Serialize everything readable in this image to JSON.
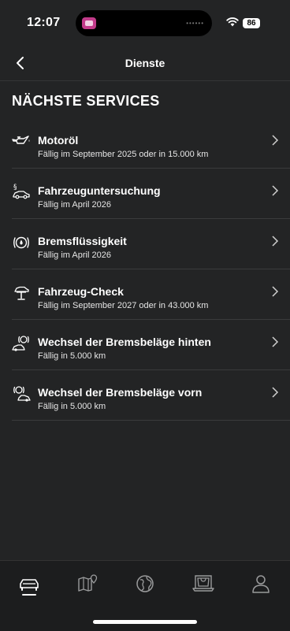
{
  "status": {
    "time": "12:07",
    "battery": "86"
  },
  "header": {
    "title": "Dienste"
  },
  "section_title": "NÄCHSTE SERVICES",
  "services": [
    {
      "icon": "oil-can-icon",
      "title": "Motoröl",
      "due": "Fällig im September 2025 oder in 15.000 km"
    },
    {
      "icon": "vehicle-inspection-icon",
      "title": "Fahrzeuguntersuchung",
      "due": "Fällig im April 2026"
    },
    {
      "icon": "brake-fluid-icon",
      "title": "Bremsflüssigkeit",
      "due": "Fällig im April 2026"
    },
    {
      "icon": "car-lift-icon",
      "title": "Fahrzeug-Check",
      "due": "Fällig im September 2027 oder in 43.000 km"
    },
    {
      "icon": "rear-brake-pads-icon",
      "title": "Wechsel der Bremsbeläge hinten",
      "due": "Fällig in 5.000 km"
    },
    {
      "icon": "front-brake-pads-icon",
      "title": "Wechsel der Bremsbeläge vorn",
      "due": "Fällig in 5.000 km"
    }
  ],
  "tabs": [
    {
      "icon": "car-icon",
      "active": true
    },
    {
      "icon": "map-icon",
      "active": false
    },
    {
      "icon": "globe-icon",
      "active": false
    },
    {
      "icon": "shop-icon",
      "active": false
    },
    {
      "icon": "profile-icon",
      "active": false
    }
  ]
}
